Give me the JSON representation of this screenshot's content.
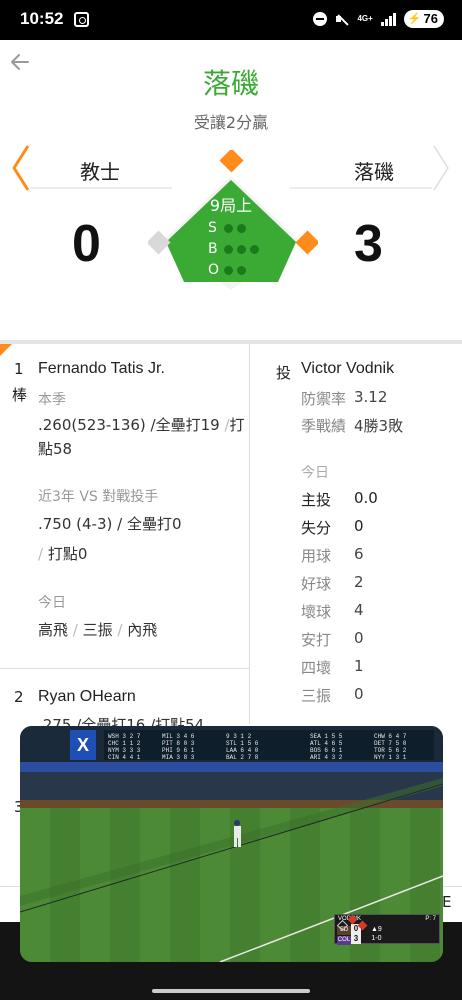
{
  "status_bar": {
    "time": "10:52",
    "network": "4G+",
    "battery": "76",
    "icons": [
      "screen-record-icon",
      "dnd-icon",
      "mute-icon",
      "signal-icon",
      "battery-icon"
    ]
  },
  "header": {
    "back_icon": "arrow-left-icon",
    "title": "落磯",
    "odds": "受讓2分贏"
  },
  "scoreboard": {
    "away": {
      "name": "教士",
      "score": "0"
    },
    "home": {
      "name": "落磯",
      "score": "3"
    },
    "inning": "9局上",
    "sbo_labels": [
      "S",
      "B",
      "O"
    ],
    "colors": {
      "green": "#3aaa35",
      "orange": "#ff8c1a",
      "empty_base": "#d9d9d9"
    }
  },
  "batter": {
    "order": "1",
    "role": "棒",
    "name": "Fernando Tatis Jr.",
    "season_label": "本季",
    "season_line1_pre": ".260(523-136) /全壘打19 ",
    "season_line1_sep": "/",
    "season_line1_post": "打",
    "season_line2": "點58",
    "vs_label": "近3年 VS 對戰投手",
    "vs_line1": ".750 (4-3) / 全壘打0",
    "vs_line2_sep": "/",
    "vs_line2_text": " 打點0",
    "today_label": "今日",
    "today": [
      "高飛",
      "三振",
      "內飛"
    ],
    "today_sep": " / "
  },
  "next_batter": {
    "order": "2",
    "name": "Ryan OHearn",
    "stats_partial": ".275 /全壘打16 /打點54"
  },
  "pitcher": {
    "role": "投",
    "name": "Victor Vodnik",
    "era_label": "防禦率",
    "era": "3.12",
    "record_label": "季戰績",
    "record": "4勝3敗",
    "today_label": "今日",
    "today_stats": [
      {
        "label": "主投",
        "value": "0.0",
        "bold": true
      },
      {
        "label": "失分",
        "value": "0",
        "bold": true
      },
      {
        "label": "用球",
        "value": "6",
        "bold": false
      },
      {
        "label": "好球",
        "value": "2",
        "bold": false
      },
      {
        "label": "壞球",
        "value": "4",
        "bold": false
      },
      {
        "label": "安打",
        "value": "0",
        "bold": false
      },
      {
        "label": "四壞",
        "value": "1",
        "bold": false
      },
      {
        "label": "三振",
        "value": "0",
        "bold": false
      }
    ]
  },
  "peek": {
    "third_order": "3",
    "right_letter": "E"
  },
  "video": {
    "logo": "X",
    "scorebug": {
      "pitcher": "VODNIK",
      "pitch_count": "P: 7",
      "away_score": "0",
      "home_score": "3",
      "away_abbr": "SD",
      "home_abbr": "COL",
      "inning": "▲9",
      "count": "1-0"
    }
  }
}
